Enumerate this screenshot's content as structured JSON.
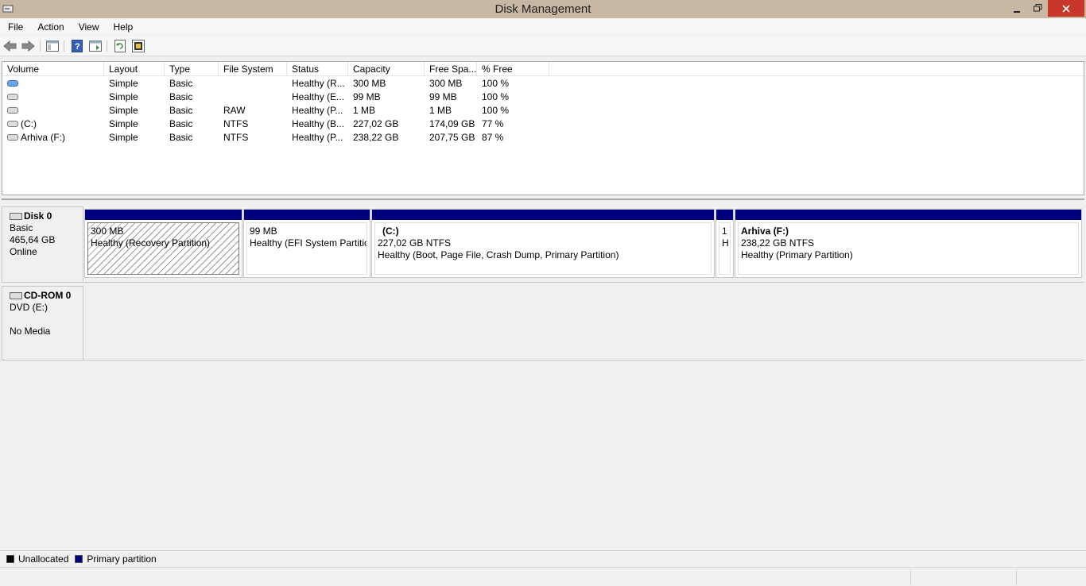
{
  "window": {
    "title": "Disk Management"
  },
  "menu": [
    "File",
    "Action",
    "View",
    "Help"
  ],
  "toolbar_icons": [
    "back-icon",
    "forward-icon",
    "show-hide-console-tree-icon",
    "help-icon",
    "properties-icon",
    "refresh-icon",
    "settings-icon"
  ],
  "list": {
    "columns": [
      "Volume",
      "Layout",
      "Type",
      "File System",
      "Status",
      "Capacity",
      "Free Spa...",
      "% Free"
    ],
    "rows": [
      {
        "volume": "",
        "layout": "Simple",
        "type": "Basic",
        "fs": "",
        "status": "Healthy (R...",
        "capacity": "300 MB",
        "free": "300 MB",
        "pct": "100 %"
      },
      {
        "volume": "",
        "layout": "Simple",
        "type": "Basic",
        "fs": "",
        "status": "Healthy (E...",
        "capacity": "99 MB",
        "free": "99 MB",
        "pct": "100 %"
      },
      {
        "volume": "",
        "layout": "Simple",
        "type": "Basic",
        "fs": "RAW",
        "status": "Healthy (P...",
        "capacity": "1 MB",
        "free": "1 MB",
        "pct": "100 %"
      },
      {
        "volume": "(C:)",
        "layout": "Simple",
        "type": "Basic",
        "fs": "NTFS",
        "status": "Healthy (B...",
        "capacity": "227,02 GB",
        "free": "174,09 GB",
        "pct": "77 %"
      },
      {
        "volume": "Arhiva (F:)",
        "layout": "Simple",
        "type": "Basic",
        "fs": "NTFS",
        "status": "Healthy (P...",
        "capacity": "238,22 GB",
        "free": "207,75 GB",
        "pct": "87 %"
      }
    ]
  },
  "disks": {
    "disk0": {
      "name": "Disk 0",
      "type": "Basic",
      "size": "465,64 GB",
      "state": "Online"
    },
    "cdrom0": {
      "name": "CD-ROM 0",
      "type": "DVD (E:)",
      "media": "No Media"
    }
  },
  "partitions": [
    {
      "title": "",
      "line1": "300 MB",
      "line2": "Healthy (Recovery Partition)"
    },
    {
      "title": "",
      "line1": "99 MB",
      "line2": "Healthy (EFI System Partitio"
    },
    {
      "title": "(C:)",
      "line1": "227,02 GB NTFS",
      "line2": "Healthy (Boot, Page File, Crash Dump, Primary Partition)"
    },
    {
      "title": "",
      "line1": "1",
      "line2": "H"
    },
    {
      "title": "Arhiva  (F:)",
      "line1": "238,22 GB NTFS",
      "line2": "Healthy (Primary Partition)"
    }
  ],
  "legend": [
    {
      "label": "Unallocated",
      "color": "#000000"
    },
    {
      "label": "Primary partition",
      "color": "#00007f"
    }
  ]
}
